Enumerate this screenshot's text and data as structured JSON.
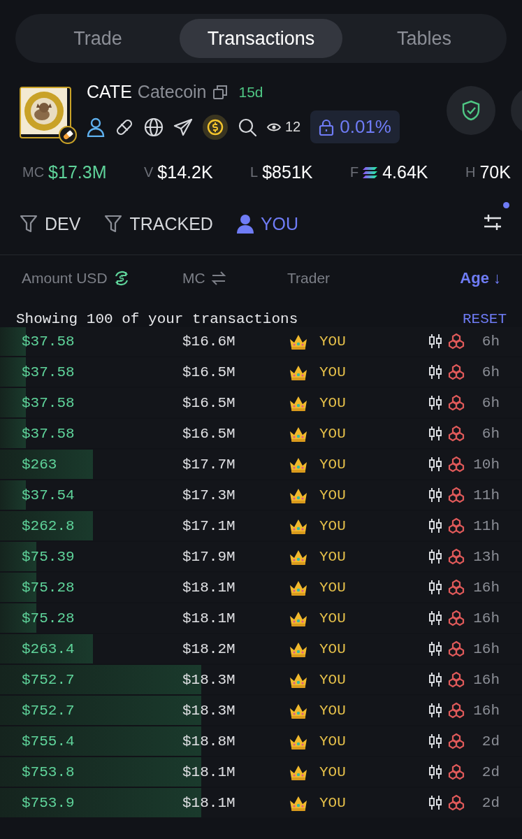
{
  "tabs": [
    {
      "label": "Trade",
      "selected": false
    },
    {
      "label": "Transactions",
      "selected": true
    },
    {
      "label": "Tables",
      "selected": false
    }
  ],
  "token": {
    "symbol": "CATE",
    "name": "Catecoin",
    "age": "15d",
    "watchers": "12",
    "lock": "0.01%"
  },
  "stats": [
    {
      "label": "MC",
      "value": "$17.3M",
      "kind": "green"
    },
    {
      "label": "V",
      "value": "$14.2K",
      "kind": "plain"
    },
    {
      "label": "L",
      "value": "$851K",
      "kind": "plain"
    },
    {
      "label": "F",
      "value": "4.64K",
      "kind": "sol"
    },
    {
      "label": "H",
      "value": "70K",
      "kind": "plain"
    }
  ],
  "filters": [
    {
      "label": "DEV",
      "kind": "funnel",
      "selected": false
    },
    {
      "label": "TRACKED",
      "kind": "funnel",
      "selected": false
    },
    {
      "label": "YOU",
      "kind": "person",
      "selected": true
    }
  ],
  "columns": [
    {
      "label": "Amount USD",
      "kind": "swap-dollar"
    },
    {
      "label": "MC",
      "kind": "swap"
    },
    {
      "label": "Trader",
      "kind": "plain"
    },
    {
      "label": "Age ↓",
      "kind": "sorted"
    }
  ],
  "summary": "Showing 100 of your transactions",
  "reset": "RESET",
  "rows": [
    {
      "amount": "$37.58",
      "level": 0.05,
      "mc": "$16.6M",
      "trader": "YOU",
      "age": "6h"
    },
    {
      "amount": "$37.58",
      "level": 0.05,
      "mc": "$16.5M",
      "trader": "YOU",
      "age": "6h"
    },
    {
      "amount": "$37.58",
      "level": 0.05,
      "mc": "$16.5M",
      "trader": "YOU",
      "age": "6h"
    },
    {
      "amount": "$37.58",
      "level": 0.05,
      "mc": "$16.5M",
      "trader": "YOU",
      "age": "6h"
    },
    {
      "amount": "$263",
      "level": 0.178,
      "mc": "$17.7M",
      "trader": "YOU",
      "age": "10h"
    },
    {
      "amount": "$37.54",
      "level": 0.05,
      "mc": "$17.3M",
      "trader": "YOU",
      "age": "11h"
    },
    {
      "amount": "$262.8",
      "level": 0.178,
      "mc": "$17.1M",
      "trader": "YOU",
      "age": "11h"
    },
    {
      "amount": "$75.39",
      "level": 0.07,
      "mc": "$17.9M",
      "trader": "YOU",
      "age": "13h"
    },
    {
      "amount": "$75.28",
      "level": 0.07,
      "mc": "$18.1M",
      "trader": "YOU",
      "age": "16h"
    },
    {
      "amount": "$75.28",
      "level": 0.07,
      "mc": "$18.1M",
      "trader": "YOU",
      "age": "16h"
    },
    {
      "amount": "$263.4",
      "level": 0.178,
      "mc": "$18.2M",
      "trader": "YOU",
      "age": "16h"
    },
    {
      "amount": "$752.7",
      "level": 0.386,
      "mc": "$18.3M",
      "trader": "YOU",
      "age": "16h"
    },
    {
      "amount": "$752.7",
      "level": 0.386,
      "mc": "$18.3M",
      "trader": "YOU",
      "age": "16h"
    },
    {
      "amount": "$755.4",
      "level": 0.386,
      "mc": "$18.8M",
      "trader": "YOU",
      "age": "2d"
    },
    {
      "amount": "$753.8",
      "level": 0.386,
      "mc": "$18.1M",
      "trader": "YOU",
      "age": "2d"
    },
    {
      "amount": "$753.9",
      "level": 0.386,
      "mc": "$18.1M",
      "trader": "YOU",
      "age": "2d"
    }
  ]
}
